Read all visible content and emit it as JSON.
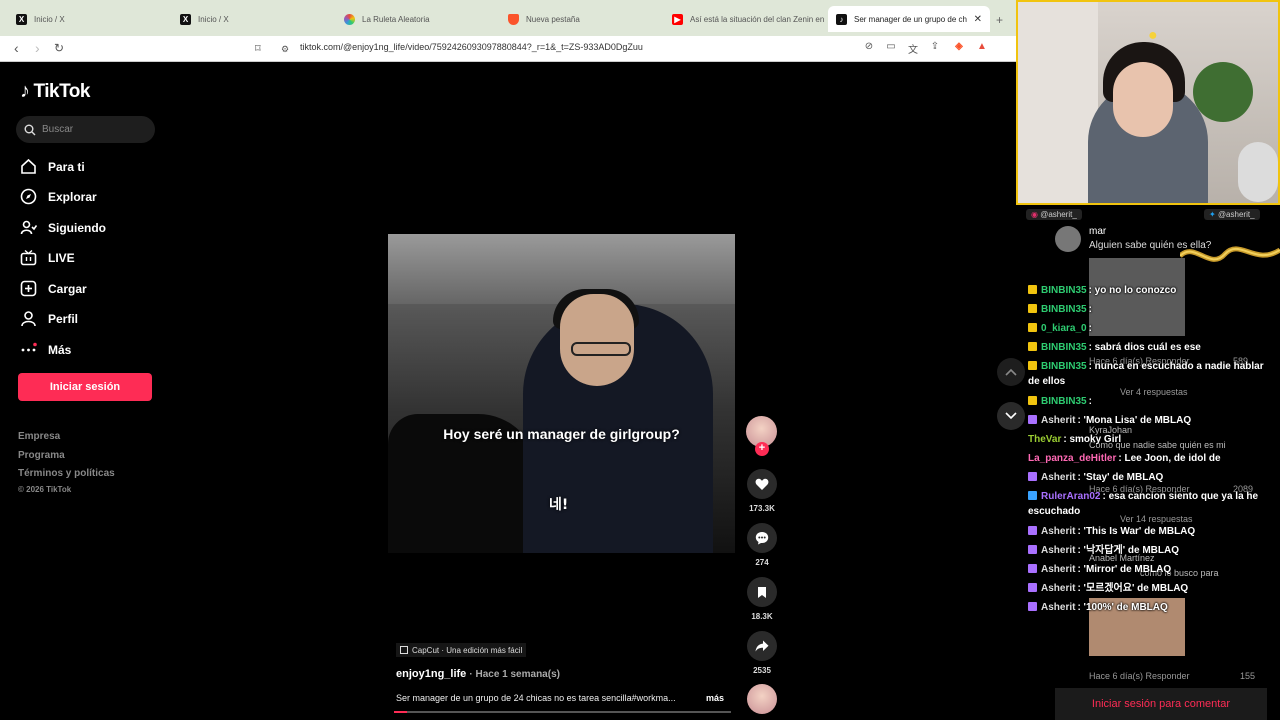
{
  "browser": {
    "tabs": [
      {
        "title": "Inicio / X",
        "icon": "x-logo-icon"
      },
      {
        "title": "Inicio / X",
        "icon": "x-logo-icon"
      },
      {
        "title": "La Ruleta Aleatoria",
        "icon": "wheel-icon"
      },
      {
        "title": "Nueva pestaña",
        "icon": "brave-icon"
      },
      {
        "title": "Así está la situación del clan Zenin en",
        "icon": "youtube-icon"
      },
      {
        "title": "Ser manager de un grupo de ch",
        "icon": "tiktok-icon",
        "active": true
      }
    ],
    "url": "tiktok.com/@enjoy1ng_life/video/7592426093097880844?_r=1&_t=ZS-933AD0DgZuu"
  },
  "sidebar": {
    "logo": "TikTok",
    "search_placeholder": "Buscar",
    "items": [
      {
        "label": "Para ti",
        "icon": "home-icon"
      },
      {
        "label": "Explorar",
        "icon": "compass-icon"
      },
      {
        "label": "Siguiendo",
        "icon": "following-icon"
      },
      {
        "label": "LIVE",
        "icon": "live-icon"
      },
      {
        "label": "Cargar",
        "icon": "upload-icon"
      },
      {
        "label": "Perfil",
        "icon": "profile-icon"
      },
      {
        "label": "Más",
        "icon": "more-icon"
      }
    ],
    "login_button": "Iniciar sesión",
    "footer": [
      "Empresa",
      "Programa",
      "Términos y políticas",
      "© 2026 TikTok"
    ]
  },
  "video": {
    "caption": "Hoy seré un manager de girlgroup?",
    "korean_sub": "네!",
    "capcut_label": "CapCut · Una edición más fácil",
    "author": "enjoy1ng_life",
    "posted": "· Hace 1 semana(s)",
    "description": "Ser manager de un grupo de 24 chicas no es tarea sencilla#workma...",
    "more": "más",
    "progress": 0.04
  },
  "actions": {
    "likes": "173.3K",
    "comments": "274",
    "saves": "18.3K",
    "shares": "2535"
  },
  "stream": {
    "handles": [
      "@asherit_",
      "@asherit_"
    ],
    "comment_top": {
      "user": "mar",
      "text": "Alguien sabe quién es ella?"
    },
    "overlay": [
      {
        "text": "Hace 6 día(s)   Responder",
        "key": "o1"
      },
      {
        "text": "Ver 4 respuestas",
        "key": "o2"
      },
      {
        "text": "KyraJohan",
        "key": "o3"
      },
      {
        "text": "Como que nadie sabe quién es mi",
        "key": "o4"
      },
      {
        "text": "Hace 6 día(s)   Responder",
        "key": "o5"
      },
      {
        "text": "Ver 14 respuestas",
        "key": "o6"
      },
      {
        "text": "Anabel Martínez",
        "key": "o7"
      },
      {
        "text": "cómo lo busco para",
        "key": "o8"
      },
      {
        "text": "Hace 6 día(s)   Responder",
        "key": "o9"
      }
    ],
    "likes_overlay": [
      "589",
      "2089",
      "155"
    ],
    "chat": [
      {
        "user": "BINBIN35",
        "text": ": yo no lo conozco",
        "color": "#2ecc71",
        "icon": "#f1c40f"
      },
      {
        "user": "BINBIN35",
        "text": ":",
        "color": "#2ecc71",
        "icon": "#f1c40f"
      },
      {
        "user": "0_kiara_0",
        "text": ":",
        "color": "#2ecc71",
        "icon": "#f1c40f"
      },
      {
        "user": "BINBIN35",
        "text": ": sabrá dios cuál es ese",
        "color": "#2ecc71",
        "icon": "#f1c40f"
      },
      {
        "user": "BINBIN35",
        "text": ": nunca en escuchado a nadie hablar de ellos",
        "color": "#2ecc71",
        "icon": "#f1c40f"
      },
      {
        "user": "BINBIN35",
        "text": ":",
        "color": "#2ecc71",
        "icon": "#f1c40f"
      },
      {
        "user": "Asherit",
        "text": ": 'Mona Lisa' de MBLAQ",
        "color": "#dcdcdc",
        "icon": "#a970ff"
      },
      {
        "user": "TheVar",
        "text": ": smoky Girl",
        "color": "#9acd32",
        "icon": ""
      },
      {
        "user": "La_panza_deHitler",
        "text": ": Lee Joon, de idol de",
        "color": "#ff69b4",
        "icon": ""
      },
      {
        "user": "Asherit",
        "text": ": 'Stay' de MBLAQ",
        "color": "#dcdcdc",
        "icon": "#a970ff"
      },
      {
        "user": "RulerAran02",
        "text": ": esa cancion siento que ya la he escuchado",
        "color": "#a970ff",
        "icon": "#3aa3ff"
      },
      {
        "user": "Asherit",
        "text": ": 'This Is War' de MBLAQ",
        "color": "#dcdcdc",
        "icon": "#a970ff"
      },
      {
        "user": "Asherit",
        "text": ": '낙자답게' de MBLAQ",
        "color": "#dcdcdc",
        "icon": "#a970ff"
      },
      {
        "user": "Asherit",
        "text": ": 'Mirror' de MBLAQ",
        "color": "#dcdcdc",
        "icon": "#a970ff"
      },
      {
        "user": "Asherit",
        "text": ": '모르겠어요' de MBLAQ",
        "color": "#dcdcdc",
        "icon": "#a970ff"
      },
      {
        "user": "Asherit",
        "text": ": '100%' de MBLAQ",
        "color": "#dcdcdc",
        "icon": "#a970ff"
      }
    ],
    "login_comment": "Iniciar sesión para comentar"
  }
}
